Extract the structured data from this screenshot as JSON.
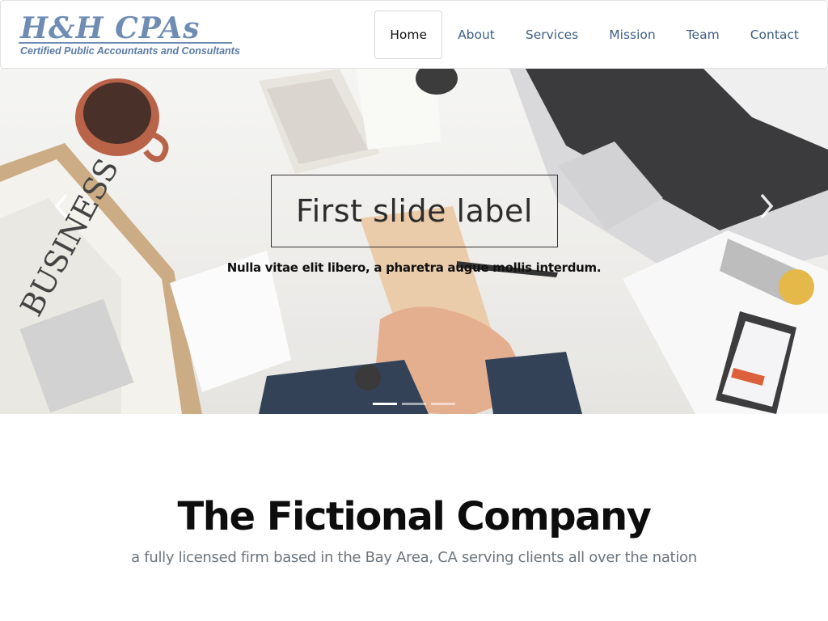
{
  "brand": {
    "name": "H&H CPAs",
    "tagline": "Certified Public Accountants and Consultants"
  },
  "nav": {
    "items": [
      {
        "label": "Home",
        "active": true
      },
      {
        "label": "About"
      },
      {
        "label": "Services"
      },
      {
        "label": "Mission"
      },
      {
        "label": "Team"
      },
      {
        "label": "Contact"
      }
    ]
  },
  "carousel": {
    "caption_title": "First slide label",
    "caption_text": "Nulla vitae elit libero, a pharetra augue mollis interdum.",
    "controls": {
      "prev_icon": "chevron-left-icon",
      "next_icon": "chevron-right-icon"
    },
    "slide_count": 3,
    "active_index": 0
  },
  "intro": {
    "title": "The Fictional Company",
    "subtitle": "a fully licensed firm based in the Bay Area, CA serving clients all over the nation"
  },
  "colors": {
    "brand": "#6f8db4",
    "nav_link": "#3f5f84",
    "muted": "#6c757d"
  }
}
